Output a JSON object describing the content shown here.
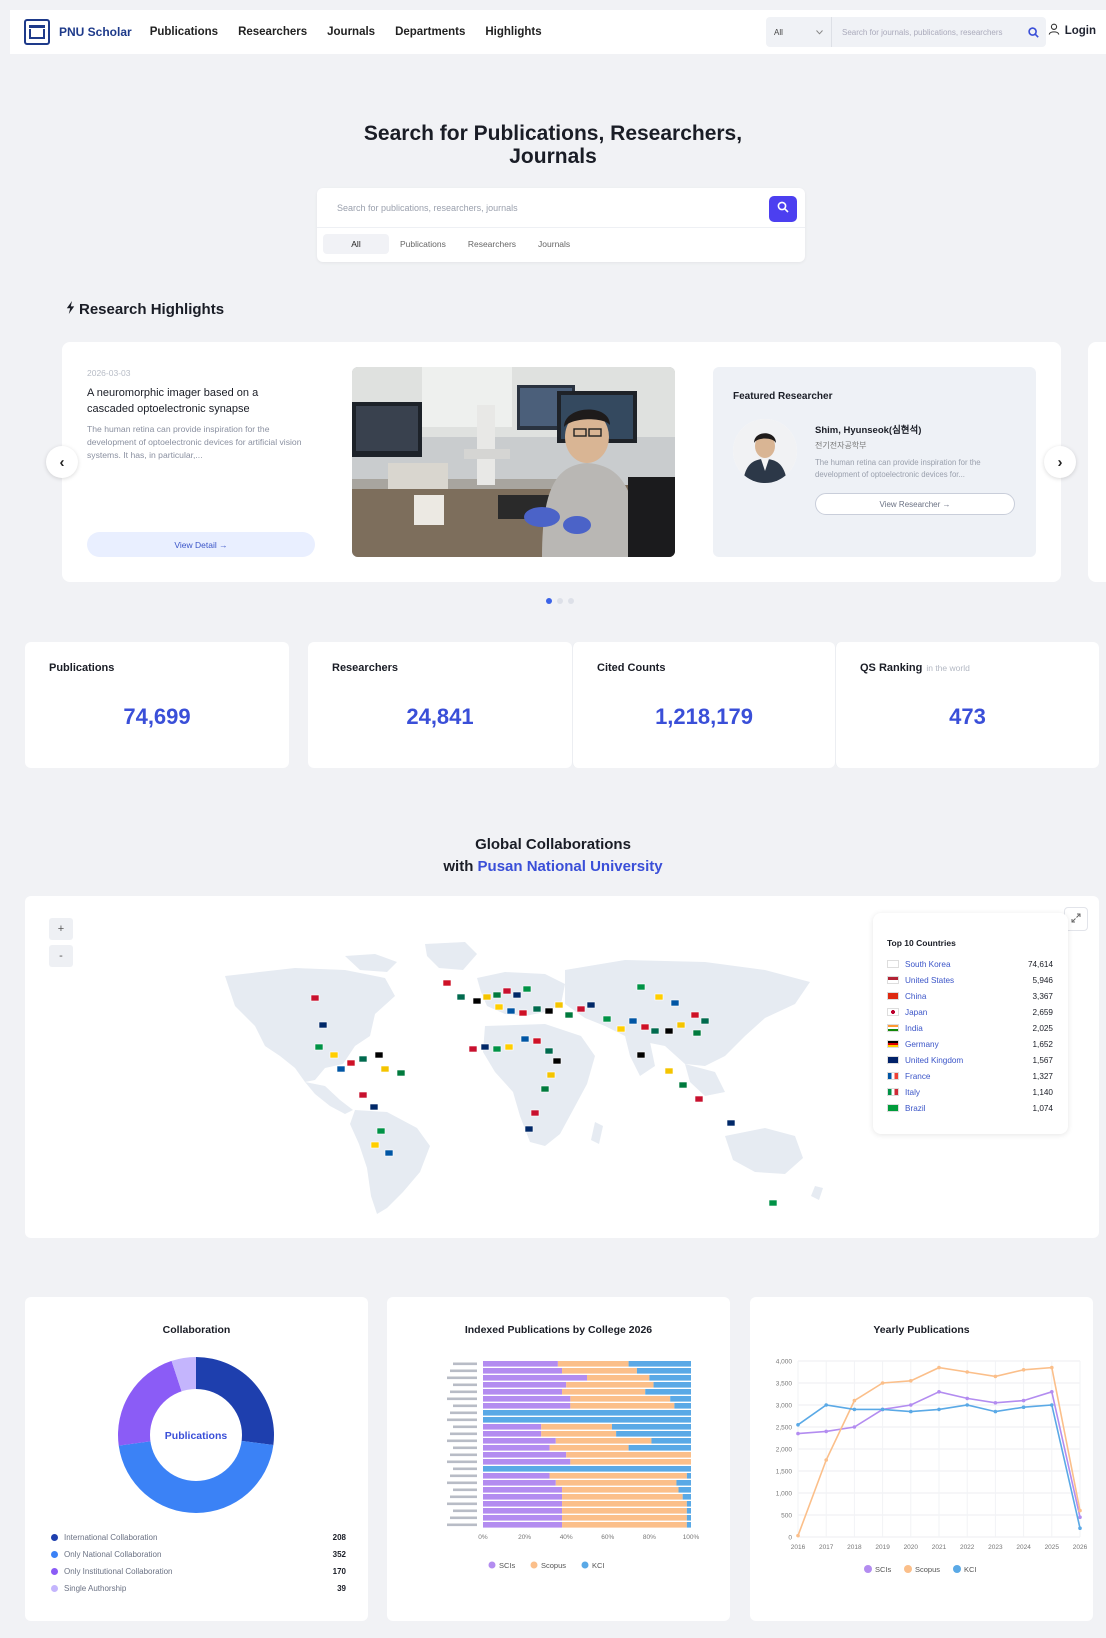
{
  "header": {
    "brand": "PNU Scholar",
    "nav": [
      "Publications",
      "Researchers",
      "Journals",
      "Departments",
      "Highlights"
    ],
    "search_scope": "All",
    "search_placeholder": "Search for journals, publications, researchers",
    "login": "Login"
  },
  "hero": {
    "title_line1": "Search for Publications, Researchers,",
    "title_line2": "Journals",
    "search_placeholder": "Search for publications, researchers, journals",
    "tabs": [
      "All",
      "Publications",
      "Researchers",
      "Journals"
    ]
  },
  "highlights": {
    "title": "Research Highlights",
    "date": "2026-03-03",
    "headline": "A neuromorphic imager based on a cascaded optoelectronic synapse",
    "summary": "The human retina can provide inspiration for the development of optoelectronic devices for artificial vision systems. It has, in particular,...",
    "view_detail": "View Detail →",
    "featured_title": "Featured Researcher",
    "researcher_name": "Shim, Hyunseok(심현석)",
    "researcher_dept": "전기전자공학부",
    "researcher_desc": "The human retina can provide inspiration for the development of optoelectronic devices for...",
    "view_researcher": "View Researcher →"
  },
  "stats": [
    {
      "label": "Publications",
      "sub": "",
      "value": "74,699"
    },
    {
      "label": "Researchers",
      "sub": "",
      "value": "24,841"
    },
    {
      "label": "Cited Counts",
      "sub": "",
      "value": "1,218,179"
    },
    {
      "label": "QS Ranking",
      "sub": "in the world",
      "value": "473"
    }
  ],
  "global": {
    "title_line1": "Global Collaborations",
    "title_prefix": "with ",
    "title_highlight": "Pusan National University",
    "zoom_in": "+",
    "zoom_out": "-",
    "top10_title": "Top 10 Countries",
    "top10": [
      {
        "country": "South Korea",
        "count": "74,614"
      },
      {
        "country": "United States",
        "count": "5,946"
      },
      {
        "country": "China",
        "count": "3,367"
      },
      {
        "country": "Japan",
        "count": "2,659"
      },
      {
        "country": "India",
        "count": "2,025"
      },
      {
        "country": "Germany",
        "count": "1,652"
      },
      {
        "country": "United Kingdom",
        "count": "1,567"
      },
      {
        "country": "France",
        "count": "1,327"
      },
      {
        "country": "Italy",
        "count": "1,140"
      },
      {
        "country": "Brazil",
        "count": "1,074"
      }
    ]
  },
  "colors": {
    "accent": "#3a4fd8",
    "button": "#4c3ff0",
    "scis": "#b38cf0",
    "scopus": "#fbbf8a",
    "kci": "#5aa9e6"
  },
  "chart_data": [
    {
      "type": "pie",
      "title": "Collaboration",
      "center_label": "Publications",
      "categories": [
        "International Collaboration",
        "Only National Collaboration",
        "Only Institutional Collaboration",
        "Single Authorship"
      ],
      "values": [
        208,
        352,
        170,
        39
      ],
      "colors": [
        "#1e3fae",
        "#3b82f6",
        "#8b5cf6",
        "#c4b5fd"
      ]
    },
    {
      "type": "bar",
      "stacked": true,
      "orientation": "horizontal",
      "title": "Indexed Publications by College 2026",
      "categories": [
        "c1",
        "c2",
        "c3",
        "c4",
        "c5",
        "c6",
        "c7",
        "c8",
        "c9",
        "c10",
        "c11",
        "c12",
        "c13",
        "c14",
        "c15",
        "c16",
        "c17",
        "c18",
        "c19",
        "c20",
        "c21",
        "c22",
        "c23",
        "c24"
      ],
      "series": [
        {
          "name": "SCIs",
          "values": [
            36,
            38,
            50,
            40,
            38,
            42,
            42,
            0,
            0,
            28,
            28,
            35,
            32,
            40,
            42,
            0,
            32,
            35,
            38,
            38,
            38,
            38,
            38,
            38
          ]
        },
        {
          "name": "Scopus",
          "values": [
            34,
            36,
            30,
            42,
            40,
            48,
            50,
            0,
            0,
            34,
            36,
            46,
            38,
            60,
            58,
            0,
            66,
            58,
            56,
            58,
            60,
            60,
            60,
            60
          ]
        },
        {
          "name": "KCI",
          "values": [
            30,
            26,
            20,
            18,
            22,
            10,
            8,
            100,
            100,
            38,
            36,
            19,
            30,
            0,
            0,
            100,
            2,
            7,
            6,
            4,
            2,
            2,
            2,
            2
          ]
        }
      ],
      "xticks": [
        "0%",
        "20%",
        "40%",
        "60%",
        "80%",
        "100%"
      ]
    },
    {
      "type": "line",
      "title": "Yearly Publications",
      "x": [
        "2016",
        "2017",
        "2018",
        "2019",
        "2020",
        "2021",
        "2022",
        "2023",
        "2024",
        "2025",
        "2026"
      ],
      "ylim": [
        0,
        4000
      ],
      "yticks": [
        "0",
        "500",
        "1,000",
        "1,500",
        "2,000",
        "2,500",
        "3,000",
        "3,500",
        "4,000"
      ],
      "series": [
        {
          "name": "SCIs",
          "values": [
            2350,
            2400,
            2500,
            2900,
            3000,
            3300,
            3150,
            3050,
            3100,
            3300,
            450
          ]
        },
        {
          "name": "Scopus",
          "values": [
            30,
            1750,
            3100,
            3500,
            3550,
            3850,
            3750,
            3650,
            3800,
            3850,
            600
          ]
        },
        {
          "name": "KCI",
          "values": [
            2550,
            3000,
            2900,
            2900,
            2850,
            2900,
            3000,
            2850,
            2950,
            3000,
            200
          ]
        }
      ]
    }
  ]
}
